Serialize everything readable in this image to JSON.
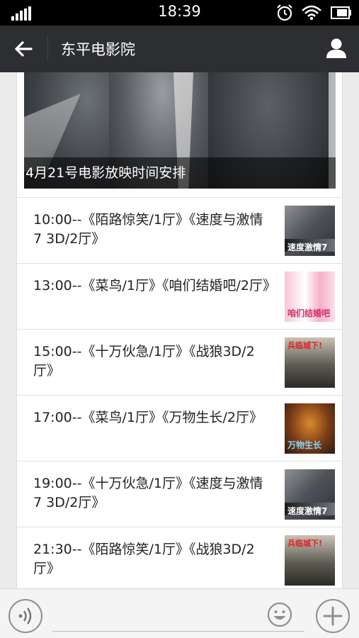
{
  "status_bar": {
    "time": "18:39",
    "icons": [
      "signal-icon",
      "alarm-icon",
      "wifi-icon",
      "battery-icon"
    ]
  },
  "nav": {
    "title": "东平电影院",
    "back_icon": "arrow-left-icon",
    "profile_icon": "person-icon"
  },
  "article": {
    "banner_caption": "4月21号电影放映时间安排",
    "schedule": [
      {
        "text": "10:00--《陌路惊笑/1厅》《速度与激情7 3D/2厅》",
        "thumb_label": "速度激情7"
      },
      {
        "text": "13:00--《菜鸟/1厅》《咱们结婚吧/2厅》",
        "thumb_label": "咱们结婚吧"
      },
      {
        "text": "15:00--《十万伙急/1厅》《战狼3D/2厅》",
        "thumb_label": "兵临城下!"
      },
      {
        "text": "17:00--《菜鸟/1厅》《万物生长/2厅》",
        "thumb_label": "万物生长"
      },
      {
        "text": "19:00--《十万伙急/1厅》《速度与激情7 3D/2厅》",
        "thumb_label": "速度激情7"
      },
      {
        "text": "21:30--《陌路惊笑/1厅》《战狼3D/2厅》",
        "thumb_label": "兵临城下!"
      }
    ]
  },
  "input_bar": {
    "icons": [
      "voice-icon",
      "emoji-icon",
      "plus-icon"
    ]
  },
  "colors": {
    "nav_bg": "#2c2e31",
    "page_bg": "#ebebeb"
  }
}
